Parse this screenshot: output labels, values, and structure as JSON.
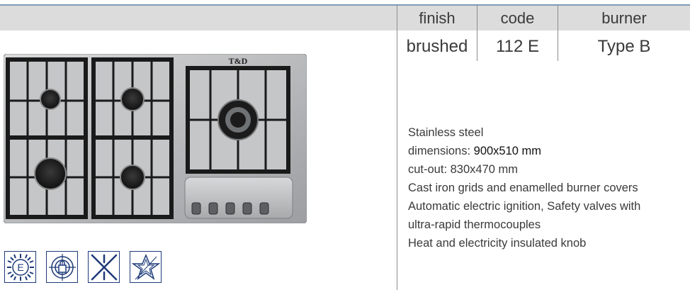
{
  "table": {
    "headers": [
      "finish",
      "code",
      "burner"
    ],
    "row": [
      "brushed",
      "112 E",
      "Type B"
    ]
  },
  "product": {
    "brand_label": "T&D",
    "features": [
      {
        "text": "Stainless steel"
      },
      {
        "prefix": "dimensions: ",
        "value": "900x510 mm"
      },
      {
        "text": "cut-out: 830x470 mm"
      },
      {
        "text": "Cast iron grids and enamelled burner covers"
      },
      {
        "text": "Automatic electric ignition, Safety valves with"
      },
      {
        "text": "ultra-rapid thermocouples"
      },
      {
        "text": "Heat and electricity insulated knob"
      }
    ]
  },
  "badges": [
    {
      "name": "energy-e-icon",
      "label": "E"
    },
    {
      "name": "safety-lock-icon"
    },
    {
      "name": "cast-iron-grid-icon"
    },
    {
      "name": "star-quality-icon"
    }
  ],
  "colors": {
    "accent_rule": "#7f9bb5",
    "header_band": "#dcdcdc",
    "badge_blue": "#1d3a78"
  }
}
